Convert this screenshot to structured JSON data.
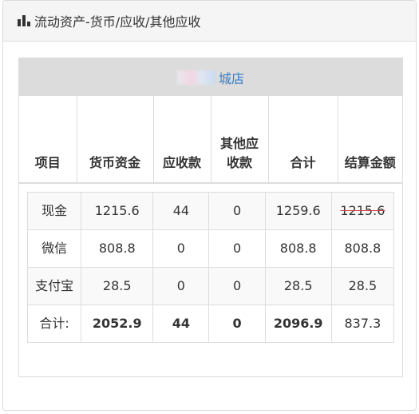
{
  "header": {
    "title": "流动资产-货币/应收/其他应收"
  },
  "store": {
    "name_suffix": "城店"
  },
  "table": {
    "columns": [
      "项目",
      "货币资金",
      "应收款",
      "其他应收款",
      "合计",
      "结算金额"
    ],
    "rows": [
      {
        "item": "现金",
        "cash": "1215.6",
        "receivable": "44",
        "other": "0",
        "total": "1259.6",
        "settle": "1215.6",
        "settle_struck": true
      },
      {
        "item": "微信",
        "cash": "808.8",
        "receivable": "0",
        "other": "0",
        "total": "808.8",
        "settle": "808.8"
      },
      {
        "item": "支付宝",
        "cash": "28.5",
        "receivable": "0",
        "other": "0",
        "total": "28.5",
        "settle": "28.5"
      },
      {
        "item": "合计:",
        "cash": "2052.9",
        "receivable": "44",
        "other": "0",
        "total": "2096.9",
        "settle": "837.3"
      }
    ]
  },
  "colors": {
    "store_link": "#3a7fc4",
    "strike": "#d04040"
  }
}
